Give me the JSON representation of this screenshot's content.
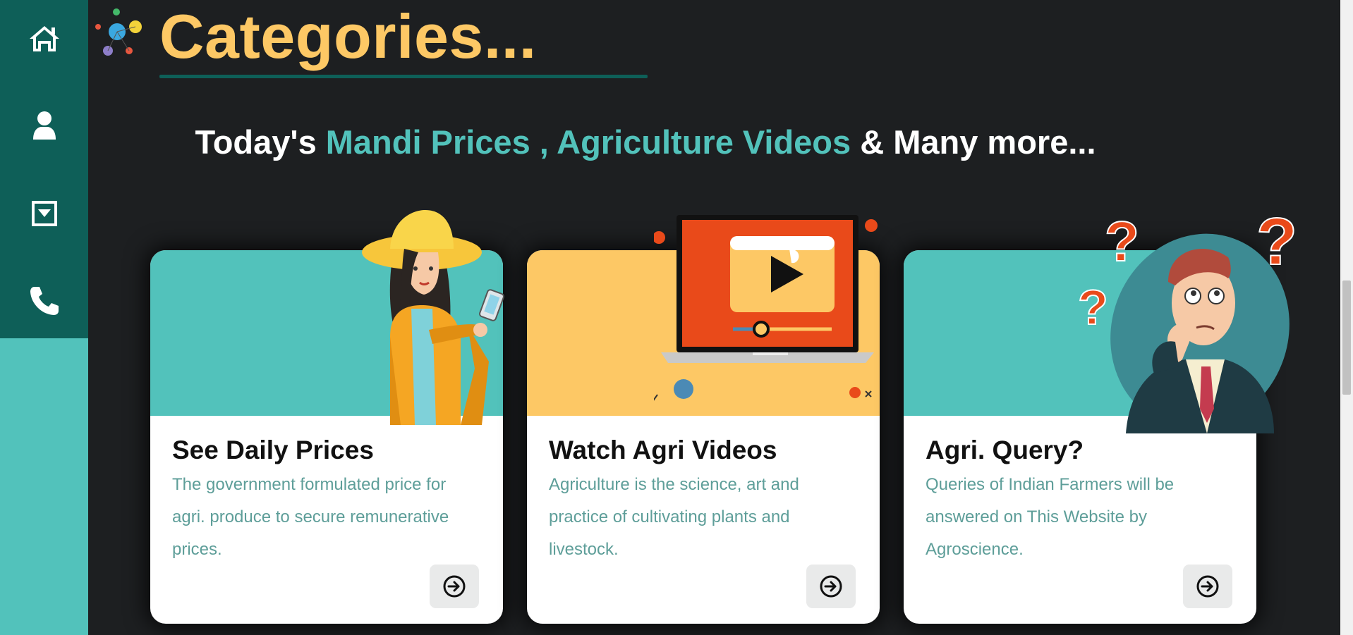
{
  "sidebar": {
    "items": [
      {
        "icon": "home-icon"
      },
      {
        "icon": "user-icon"
      },
      {
        "icon": "caret-square-down-icon"
      },
      {
        "icon": "phone-icon"
      }
    ]
  },
  "header": {
    "title": "Categories...",
    "subtitle_part1": "Today's ",
    "subtitle_accent": "Mandi Prices , Agriculture Videos",
    "subtitle_part2": " & Many more..."
  },
  "cards": [
    {
      "title": "See Daily Prices",
      "description": "The government formulated price for agri. produce to secure remunerative prices.",
      "banner_color": "#52c2bb",
      "icon": "arrow-circle-right-icon"
    },
    {
      "title": "Watch Agri Videos",
      "description": "Agriculture is the science, art and practice of cultivating plants and livestock.",
      "banner_color": "#fdc865",
      "icon": "arrow-circle-right-icon"
    },
    {
      "title": "Agri. Query?",
      "description": "Queries of Indian Farmers will be answered on This Website by Agroscience.",
      "banner_color": "#52c2bb",
      "icon": "arrow-circle-right-icon"
    }
  ],
  "colors": {
    "background": "#1d1f21",
    "sidebar_dark": "#0e5f58",
    "sidebar_light": "#52c2bb",
    "accent_yellow": "#fdc865",
    "accent_teal": "#52c2bb",
    "video_red": "#e94a1a"
  }
}
